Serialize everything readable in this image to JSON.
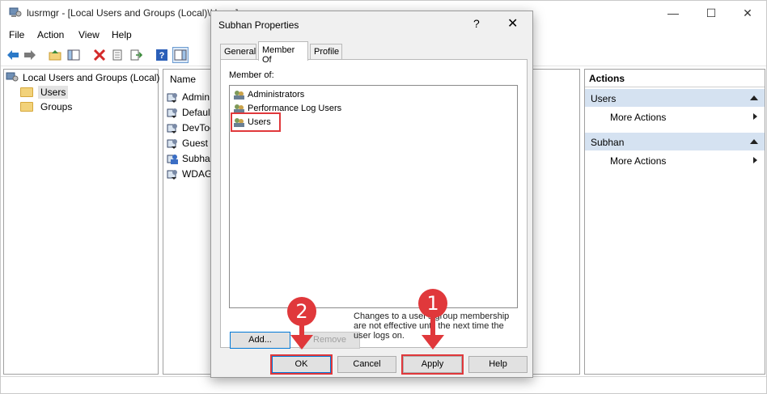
{
  "window": {
    "title": "lusrmgr - [Local Users and Groups (Local)\\Users]",
    "controls": {
      "minimize": "—",
      "maximize": "☐",
      "close": "✕"
    }
  },
  "menu": [
    "File",
    "Action",
    "View",
    "Help"
  ],
  "toolbar": [
    "back-icon",
    "forward-icon",
    "up-folder-icon",
    "show-hide-tree-icon",
    "delete-icon",
    "properties-icon",
    "export-icon",
    "help-icon",
    "action-pane-icon"
  ],
  "tree": {
    "root": "Local Users and Groups (Local)",
    "children": [
      "Users",
      "Groups"
    ]
  },
  "list": {
    "column_name": "Name",
    "rows": [
      "Admin",
      "Default",
      "DevToo",
      "Guest",
      "Subhar",
      "WDAGU"
    ]
  },
  "actions": {
    "title": "Actions",
    "sections": [
      {
        "name": "Users",
        "item": "More Actions"
      },
      {
        "name": "Subhan",
        "item": "More Actions"
      }
    ]
  },
  "dialog": {
    "title": "Subhan Properties",
    "help": "?",
    "close": "✕",
    "tabs": [
      "General",
      "Member Of",
      "Profile"
    ],
    "member_of_label": "Member of:",
    "members": [
      "Administrators",
      "Performance Log Users",
      "Users"
    ],
    "add_button": "Add...",
    "remove_button": "Remove",
    "note": "Changes to a user's group membership are not effective until the next time the user logs on.",
    "buttons": {
      "ok": "OK",
      "cancel": "Cancel",
      "apply": "Apply",
      "help": "Help"
    }
  },
  "annotations": {
    "step1": "1",
    "step2": "2"
  },
  "colors": {
    "highlight": "#e0383b",
    "actions_section": "#d5e2f1",
    "default_button_border": "#0078d7"
  }
}
